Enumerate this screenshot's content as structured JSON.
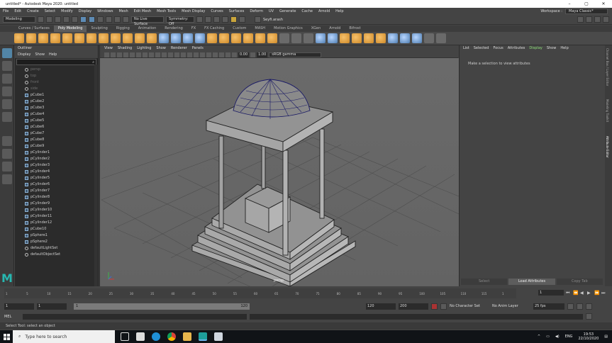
{
  "window": {
    "title": "untitled* - Autodesk Maya 2020: untitled"
  },
  "menu": [
    "File",
    "Edit",
    "Create",
    "Select",
    "Modify",
    "Display",
    "Windows",
    "Mesh",
    "Edit Mesh",
    "Mesh Tools",
    "Mesh Display",
    "Curves",
    "Surfaces",
    "Deform",
    "UV",
    "Generate",
    "Cache",
    "Arnold",
    "Help"
  ],
  "workspace": {
    "label": "Workspace :",
    "value": "Maya Classic*"
  },
  "status_line": {
    "mode": "Modeling",
    "live_surface": "No Live Surface",
    "symmetry": "Symmetry: Off",
    "user": "Seyfi.arash"
  },
  "shelf_tabs": [
    "Curves / Surfaces",
    "Poly Modeling",
    "Sculpting",
    "Rigging",
    "Animation",
    "Rendering",
    "FX",
    "FX Caching",
    "Custom",
    "MASH",
    "Motion Graphics",
    "XGen",
    "Arnold",
    "Bifrost"
  ],
  "active_shelf_tab": "Poly Modeling",
  "outliner": {
    "title": "Outliner",
    "menu": [
      "Display",
      "Show",
      "Help"
    ],
    "hidden_items": [
      "persp",
      "top",
      "front",
      "side"
    ],
    "items": [
      "pCube1",
      "pCube2",
      "pCube3",
      "pCube4",
      "pCube5",
      "pCube6",
      "pCube7",
      "pCube8",
      "pCube9",
      "pCylinder1",
      "pCylinder2",
      "pCylinder3",
      "pCylinder4",
      "pCylinder5",
      "pCylinder6",
      "pCylinder7",
      "pCylinder8",
      "pCylinder9",
      "pCylinder10",
      "pCylinder11",
      "pCylinder12",
      "pCube10",
      "pSphere1",
      "pSphere2"
    ],
    "sets": [
      "defaultLightSet",
      "defaultObjectSet"
    ]
  },
  "viewport": {
    "menu": [
      "View",
      "Shading",
      "Lighting",
      "Show",
      "Renderer",
      "Panels"
    ],
    "exposure": "0.00",
    "gamma": "1.00",
    "color_space": "sRGB gamma",
    "camera": "persp"
  },
  "attribute_editor": {
    "menu": [
      "List",
      "Selected",
      "Focus",
      "Attributes",
      "Display",
      "Show",
      "Help"
    ],
    "highlighted_menu": "Display",
    "message": "Make a selection to view attributes",
    "buttons": [
      "Select",
      "Load Attributes",
      "Copy Tab"
    ]
  },
  "side_tabs": [
    "Channel Box / Layer Editor",
    "Modeling Toolkit",
    "Attribute Editor"
  ],
  "time_slider": {
    "ticks": [
      "1",
      "5",
      "10",
      "15",
      "20",
      "25",
      "30",
      "35",
      "40",
      "45",
      "50",
      "55",
      "60",
      "65",
      "70",
      "75",
      "80",
      "85",
      "90",
      "95",
      "100",
      "105",
      "110",
      "115",
      "1"
    ],
    "current_frame": "1"
  },
  "range": {
    "start": "1",
    "inner_start": "1",
    "slider_start": "1",
    "slider_end": "120",
    "end": "120",
    "max": "200",
    "character_set": "No Character Set",
    "anim_layer": "No Anim Layer",
    "fps": "25 fps"
  },
  "mel": {
    "label": "MEL"
  },
  "help_line": "Select Tool: select an object",
  "taskbar": {
    "search_placeholder": "Type here to search",
    "language": "ENG",
    "time": "19:53",
    "date": "22/10/2020"
  }
}
